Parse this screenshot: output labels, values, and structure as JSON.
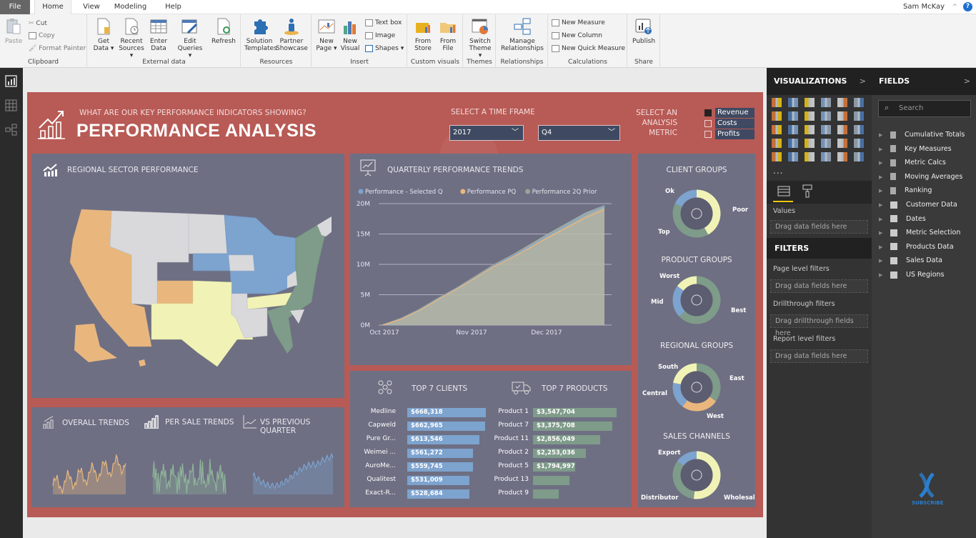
{
  "menu": {
    "tabs": [
      "File",
      "Home",
      "View",
      "Modeling",
      "Help"
    ],
    "user": "Sam McKay",
    "help_icon": "?"
  },
  "ribbon": {
    "clipboard": {
      "label": "Clipboard",
      "paste": "Paste",
      "cut": "Cut",
      "copy": "Copy",
      "format_painter": "Format Painter"
    },
    "external_data": {
      "label": "External data",
      "get_data": [
        "Get",
        "Data ▾"
      ],
      "recent_sources": [
        "Recent",
        "Sources ▾"
      ],
      "enter_data": [
        "Enter",
        "Data"
      ],
      "edit_queries": [
        "Edit",
        "Queries ▾"
      ],
      "refresh": "Refresh"
    },
    "resources": {
      "label": "Resources",
      "solution_templates": [
        "Solution",
        "Templates"
      ],
      "partner_showcase": [
        "Partner",
        "Showcase"
      ]
    },
    "insert": {
      "label": "Insert",
      "new_page": [
        "New",
        "Page ▾"
      ],
      "new_visual": [
        "New",
        "Visual"
      ],
      "text_box": "Text box",
      "image": "Image",
      "shapes": "Shapes ▾"
    },
    "custom_visuals": {
      "label": "Custom visuals",
      "from_store": [
        "From",
        "Store"
      ],
      "from_file": [
        "From",
        "File"
      ]
    },
    "themes": {
      "label": "Themes",
      "switch_theme": [
        "Switch",
        "Theme ▾"
      ]
    },
    "relationships": {
      "label": "Relationships",
      "manage": [
        "Manage",
        "Relationships"
      ]
    },
    "calculations": {
      "label": "Calculations",
      "new_measure": "New Measure",
      "new_column": "New Column",
      "new_quick_measure": "New Quick Measure"
    },
    "share": {
      "label": "Share",
      "publish": "Publish"
    }
  },
  "report": {
    "subtitle": "WHAT ARE OUR KEY PERFORMANCE INDICATORS SHOWING?",
    "title": "PERFORMANCE ANALYSIS",
    "time_frame_label": "SELECT A TIME FRAME",
    "year": "2017",
    "quarter": "Q4",
    "metric_label": [
      "SELECT AN",
      "ANALYSIS",
      "METRIC"
    ],
    "metrics": [
      {
        "label": "Revenue",
        "checked": true
      },
      {
        "label": "Costs",
        "checked": false
      },
      {
        "label": "Profits",
        "checked": false
      }
    ],
    "map_title": "REGIONAL SECTOR PERFORMANCE",
    "trends": {
      "overall": "OVERALL TRENDS",
      "per_sale": "PER SALE TRENDS",
      "vs_prev": "VS PREVIOUS QUARTER"
    },
    "clients_title": "TOP 7 CLIENTS",
    "products_title": "TOP 7 PRODUCTS",
    "donut_titles": [
      "CLIENT GROUPS",
      "PRODUCT GROUPS",
      "REGIONAL GROUPS",
      "SALES CHANNELS"
    ]
  },
  "colors": {
    "blue": "#7da3cf",
    "orange": "#e9b77e",
    "green": "#7f9b8a",
    "yellow": "#f1f3b6",
    "grey": "#d9d9dc",
    "panel": "#6e6f83",
    "report_bg": "#b85a55"
  },
  "chart_data": [
    {
      "type": "area",
      "title": "QUARTERLY PERFORMANCE TRENDS",
      "x": [
        "Oct 2017",
        "Nov 2017",
        "Dec 2017"
      ],
      "yticks": [
        "0M",
        "5M",
        "10M",
        "15M",
        "20M"
      ],
      "ylim": [
        0,
        20000000
      ],
      "series": [
        {
          "name": "Performance - Selected Q",
          "color": "#7da3cf",
          "values": [
            0,
            1000000,
            2500000,
            4300000,
            6000000,
            7800000,
            9700000,
            11300000,
            13000000,
            14800000,
            16500000,
            18200000,
            19600000
          ]
        },
        {
          "name": "Performance PQ",
          "color": "#e9b77e",
          "values": [
            0,
            950000,
            2400000,
            4200000,
            5900000,
            7700000,
            9600000,
            11100000,
            12800000,
            14500000,
            16100000,
            17700000,
            19000000
          ]
        },
        {
          "name": "Performance 2Q Prior",
          "color": "#9aa39a",
          "values": [
            0,
            1100000,
            2600000,
            4400000,
            6100000,
            8000000,
            9900000,
            11500000,
            13300000,
            15100000,
            16800000,
            18500000,
            19700000
          ]
        }
      ],
      "grid": true,
      "legend": "top-left"
    },
    {
      "type": "bar",
      "title": "TOP 7 CLIENTS",
      "categories": [
        "Medline",
        "Capweld",
        "Pure Gr...",
        "Weimei ...",
        "AuroMe...",
        "Qualitest",
        "Exact-R..."
      ],
      "values": [
        668318,
        662965,
        613546,
        561272,
        559745,
        531009,
        528684
      ],
      "labels": [
        "$668,318",
        "$662,965",
        "$613,546",
        "$561,272",
        "$559,745",
        "$531,009",
        "$528,684"
      ]
    },
    {
      "type": "bar",
      "title": "TOP 7 PRODUCTS",
      "categories": [
        "Product 1",
        "Product 7",
        "Product 11",
        "Product 2",
        "Product 5",
        "Product 13",
        "Product 9"
      ],
      "values": [
        3547704,
        3375708,
        2856049,
        2253036,
        1794997,
        1550000,
        1100000
      ],
      "labels": [
        "$3,547,704",
        "$3,375,708",
        "$2,856,049",
        "$2,253,036",
        "$1,794,997",
        "",
        ""
      ]
    },
    {
      "type": "pie",
      "title": "CLIENT GROUPS",
      "categories": [
        "Poor",
        "Top",
        "Ok"
      ],
      "values": [
        42,
        40,
        18
      ],
      "colors": [
        "#f1f3b6",
        "#7f9b8a",
        "#7da3cf"
      ]
    },
    {
      "type": "pie",
      "title": "PRODUCT GROUPS",
      "categories": [
        "Best",
        "Mid",
        "Worst"
      ],
      "values": [
        63,
        22,
        15
      ],
      "colors": [
        "#7f9b8a",
        "#7da3cf",
        "#f1f3b6"
      ]
    },
    {
      "type": "pie",
      "title": "REGIONAL GROUPS",
      "categories": [
        "East",
        "West",
        "Central",
        "South"
      ],
      "values": [
        35,
        25,
        18,
        22
      ],
      "colors": [
        "#7f9b8a",
        "#e9b77e",
        "#7da3cf",
        "#f1f3b6"
      ]
    },
    {
      "type": "pie",
      "title": "SALES CHANNELS",
      "categories": [
        "Wholesale",
        "Distributor",
        "Export"
      ],
      "values": [
        52,
        33,
        15
      ],
      "colors": [
        "#f1f3b6",
        "#7f9b8a",
        "#7da3cf"
      ]
    }
  ],
  "visualizations": {
    "title": "VISUALIZATIONS",
    "more": "...",
    "values_label": "Values",
    "drop_hint": "Drag data fields here"
  },
  "filters": {
    "title": "FILTERS",
    "page_level": "Page level filters",
    "page_drop": "Drag data fields here",
    "drillthrough": "Drillthrough filters",
    "drill_drop": "Drag drillthrough fields here",
    "report_level": "Report level filters",
    "report_drop": "Drag data fields here"
  },
  "fields": {
    "title": "FIELDS",
    "search_placeholder": "Search",
    "items": [
      {
        "label": "Cumulative Totals",
        "kind": "measure"
      },
      {
        "label": "Key Measures",
        "kind": "measure"
      },
      {
        "label": "Metric Calcs",
        "kind": "measure"
      },
      {
        "label": "Moving Averages",
        "kind": "measure"
      },
      {
        "label": "Ranking",
        "kind": "measure"
      },
      {
        "label": "Customer Data",
        "kind": "table"
      },
      {
        "label": "Dates",
        "kind": "table"
      },
      {
        "label": "Metric Selection",
        "kind": "table"
      },
      {
        "label": "Products Data",
        "kind": "table"
      },
      {
        "label": "Sales Data",
        "kind": "table"
      },
      {
        "label": "US Regions",
        "kind": "table"
      }
    ]
  },
  "watermark": "SUBSCRIBE"
}
